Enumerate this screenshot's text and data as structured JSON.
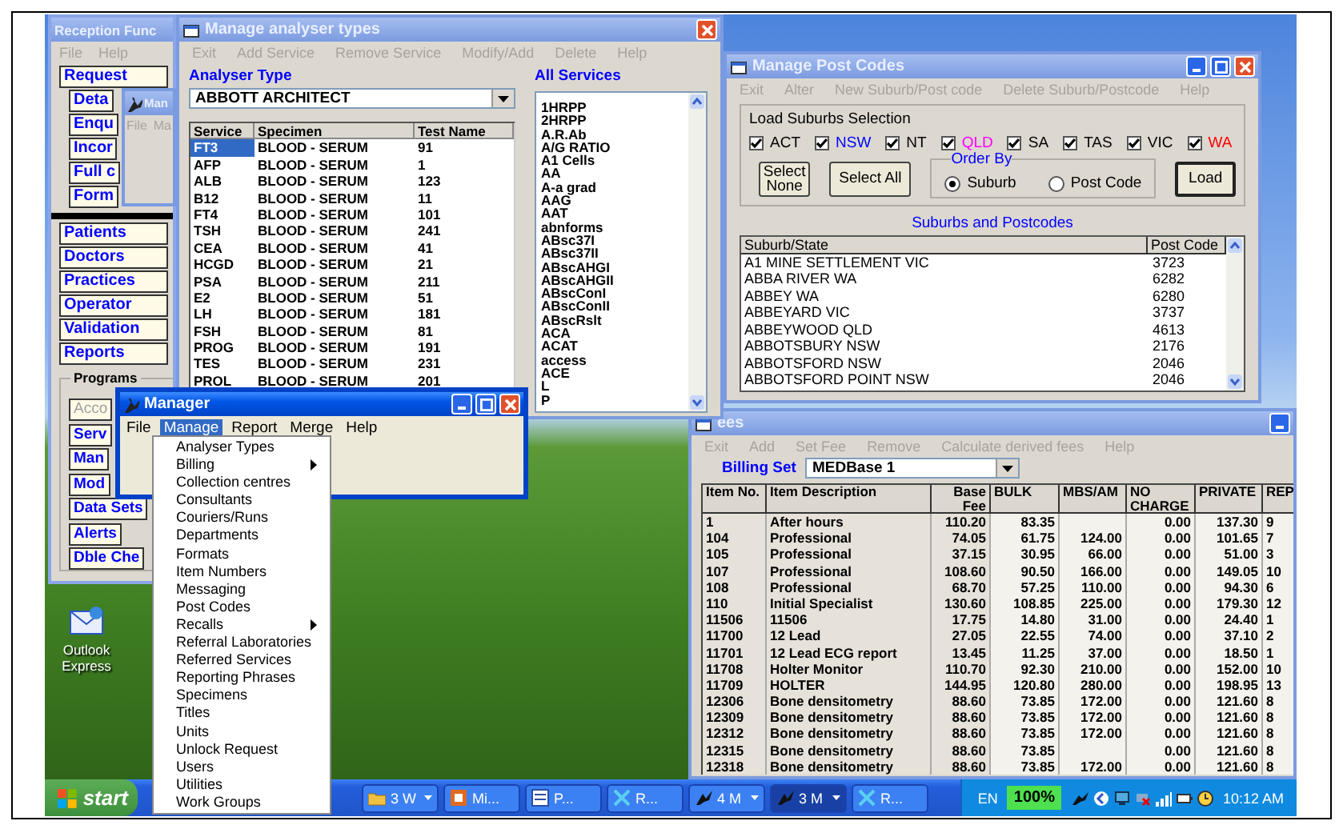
{
  "reception_window": {
    "title": "Reception Func",
    "active": false,
    "menu": [
      {
        "label": "File",
        "disabled": true
      },
      {
        "label": "Help",
        "disabled": true
      }
    ],
    "buttons": [
      {
        "label": "Request",
        "kind": "main"
      },
      {
        "label": "Deta",
        "kind": "sub"
      },
      {
        "label": "Enqu",
        "kind": "sub"
      },
      {
        "label": "Incor",
        "kind": "sub"
      },
      {
        "label": "Full c",
        "kind": "sub"
      },
      {
        "label": "Form",
        "kind": "sub"
      }
    ],
    "lower_buttons": [
      {
        "label": "Patients"
      },
      {
        "label": "Doctors"
      },
      {
        "label": "Practices"
      },
      {
        "label": "Operator"
      },
      {
        "label": "Validation"
      },
      {
        "label": "Reports"
      }
    ],
    "programs": {
      "label": "Programs",
      "buttons": [
        {
          "label": "Acco",
          "disabled": true
        },
        {
          "label": "Serv",
          "disabled": false
        },
        {
          "label": "Man",
          "disabled": false
        },
        {
          "label": "Mod",
          "disabled": false
        },
        {
          "label": "Data Sets",
          "disabled": false
        },
        {
          "label": "Alerts",
          "disabled": false
        },
        {
          "label": "Dble Che",
          "disabled": false
        }
      ]
    }
  },
  "small_window": {
    "title": "Man",
    "active": false,
    "menu": [
      {
        "label": "File",
        "disabled": true
      },
      {
        "label": "Ma",
        "disabled": true
      }
    ]
  },
  "analyser_window": {
    "title": "Manage analyser types",
    "active": false,
    "menu": [
      {
        "label": "Exit",
        "disabled": true
      },
      {
        "label": "Add Service",
        "disabled": true
      },
      {
        "label": "Remove Service",
        "disabled": true
      },
      {
        "label": "Modify/Add",
        "disabled": true
      },
      {
        "label": "Delete",
        "disabled": true
      },
      {
        "label": "Help",
        "disabled": true
      }
    ],
    "analyser_type_label": "Analyser Type",
    "analyser_type": "ABBOTT ARCHITECT",
    "table": {
      "columns": [
        "Service",
        "Specimen",
        "Test Name"
      ],
      "rows": [
        {
          "cells": [
            "FT3",
            "BLOOD - SERUM",
            "91"
          ],
          "selected": true
        },
        {
          "cells": [
            "AFP",
            "BLOOD - SERUM",
            "1"
          ],
          "selected": false
        },
        {
          "cells": [
            "ALB",
            "BLOOD - SERUM",
            "123"
          ],
          "selected": false
        },
        {
          "cells": [
            "B12",
            "BLOOD - SERUM",
            "11"
          ],
          "selected": false
        },
        {
          "cells": [
            "FT4",
            "BLOOD - SERUM",
            "101"
          ],
          "selected": false
        },
        {
          "cells": [
            "TSH",
            "BLOOD - SERUM",
            "241"
          ],
          "selected": false
        },
        {
          "cells": [
            "CEA",
            "BLOOD - SERUM",
            "41"
          ],
          "selected": false
        },
        {
          "cells": [
            "HCGD",
            "BLOOD - SERUM",
            "21"
          ],
          "selected": false
        },
        {
          "cells": [
            "PSA",
            "BLOOD - SERUM",
            "211"
          ],
          "selected": false
        },
        {
          "cells": [
            "E2",
            "BLOOD - SERUM",
            "51"
          ],
          "selected": false
        },
        {
          "cells": [
            "LH",
            "BLOOD - SERUM",
            "181"
          ],
          "selected": false
        },
        {
          "cells": [
            "FSH",
            "BLOOD - SERUM",
            "81"
          ],
          "selected": false
        },
        {
          "cells": [
            "PROG",
            "BLOOD - SERUM",
            "191"
          ],
          "selected": false
        },
        {
          "cells": [
            "TES",
            "BLOOD - SERUM",
            "231"
          ],
          "selected": false
        },
        {
          "cells": [
            "PROL",
            "BLOOD - SERUM",
            "201"
          ],
          "selected": false
        }
      ]
    },
    "all_services_label": "All Services",
    "all_services": [
      "1HRPP",
      "2HRPP",
      "A.R.Ab",
      "A/G RATIO",
      "A1 Cells",
      "AA",
      "A-a grad",
      "AAG",
      "AAT",
      "abnforms",
      "ABsc37I",
      "ABsc37II",
      "ABscAHGI",
      "ABscAHGII",
      "ABscConI",
      "ABscConII",
      "ABscRslt",
      "ACA",
      "ACAT",
      "access",
      "ACE",
      "L",
      "P"
    ]
  },
  "postcodes_window": {
    "title": "Manage Post Codes",
    "active": false,
    "menu": [
      {
        "label": "Exit",
        "disabled": true
      },
      {
        "label": "Alter",
        "disabled": true
      },
      {
        "label": "New Suburb/Post code",
        "disabled": true
      },
      {
        "label": "Delete Suburb/Postcode",
        "disabled": true
      },
      {
        "label": "Help",
        "disabled": true
      }
    ],
    "selection_label": "Load Suburbs Selection",
    "states": [
      {
        "label": "ACT",
        "checked": true,
        "color": "#000000"
      },
      {
        "label": "NSW",
        "checked": true,
        "color": "#0000ff"
      },
      {
        "label": "NT",
        "checked": true,
        "color": "#000000"
      },
      {
        "label": "QLD",
        "checked": true,
        "color": "#ff00ff"
      },
      {
        "label": "SA",
        "checked": true,
        "color": "#000000"
      },
      {
        "label": "TAS",
        "checked": true,
        "color": "#000000"
      },
      {
        "label": "VIC",
        "checked": true,
        "color": "#000000"
      },
      {
        "label": "WA",
        "checked": true,
        "color": "#ff0000"
      }
    ],
    "select_none": "Select None",
    "select_all": "Select All",
    "order_by": {
      "label": "Order By",
      "options": [
        {
          "label": "Suburb",
          "selected": true
        },
        {
          "label": "Post Code",
          "selected": false
        }
      ]
    },
    "load": "Load",
    "list_title": "Suburbs and Postcodes",
    "table": {
      "columns": [
        "Suburb/State",
        "Post Code"
      ],
      "rows": [
        [
          "A1 MINE SETTLEMENT VIC",
          "3723"
        ],
        [
          "ABBA RIVER WA",
          "6282"
        ],
        [
          "ABBEY WA",
          "6280"
        ],
        [
          "ABBEYARD VIC",
          "3737"
        ],
        [
          "ABBEYWOOD QLD",
          "4613"
        ],
        [
          "ABBOTSBURY NSW",
          "2176"
        ],
        [
          "ABBOTSFORD NSW",
          "2046"
        ],
        [
          "ABBOTSFORD POINT NSW",
          "2046"
        ]
      ]
    }
  },
  "fees_window": {
    "title": "ees",
    "active": false,
    "menu": [
      {
        "label": "Exit",
        "disabled": true
      },
      {
        "label": "Add",
        "disabled": true
      },
      {
        "label": "Set Fee",
        "disabled": true
      },
      {
        "label": "Remove",
        "disabled": true
      },
      {
        "label": "Calculate derived fees",
        "disabled": true
      },
      {
        "label": "Help",
        "disabled": true
      }
    ],
    "billing_set_label": "Billing Set",
    "billing_set": "MEDBase 1",
    "table": {
      "columns": [
        "Item No.",
        "Item Description",
        "Base Fee",
        "BULK",
        "MBS/AM",
        "NO CHARGE",
        "PRIVATE",
        "REP"
      ],
      "rows": [
        [
          "1",
          "After hours",
          "110.20",
          "83.35",
          null,
          "0.00",
          "137.30",
          "9"
        ],
        [
          "104",
          "Professional",
          "74.05",
          "61.75",
          "124.00",
          "0.00",
          "101.65",
          "7"
        ],
        [
          "105",
          "Professional",
          "37.15",
          "30.95",
          "66.00",
          "0.00",
          "51.00",
          "3"
        ],
        [
          "107",
          "Professional",
          "108.60",
          "90.50",
          "166.00",
          "0.00",
          "149.05",
          "10"
        ],
        [
          "108",
          "Professional",
          "68.70",
          "57.25",
          "110.00",
          "0.00",
          "94.30",
          "6"
        ],
        [
          "110",
          "Initial Specialist",
          "130.60",
          "108.85",
          "225.00",
          "0.00",
          "179.30",
          "12"
        ],
        [
          "11506",
          "11506",
          "17.75",
          "14.80",
          "31.00",
          "0.00",
          "24.40",
          "1"
        ],
        [
          "11700",
          "12 Lead",
          "27.05",
          "22.55",
          "74.00",
          "0.00",
          "37.10",
          "2"
        ],
        [
          "11701",
          "12 Lead ECG report",
          "13.45",
          "11.25",
          "37.00",
          "0.00",
          "18.50",
          "1"
        ],
        [
          "11708",
          "Holter Monitor",
          "110.70",
          "92.30",
          "210.00",
          "0.00",
          "152.00",
          "10"
        ],
        [
          "11709",
          "HOLTER",
          "144.95",
          "120.80",
          "280.00",
          "0.00",
          "198.95",
          "13"
        ],
        [
          "12306",
          "Bone densitometry",
          "88.60",
          "73.85",
          "172.00",
          "0.00",
          "121.60",
          "8"
        ],
        [
          "12309",
          "Bone densitometry",
          "88.60",
          "73.85",
          "172.00",
          "0.00",
          "121.60",
          "8"
        ],
        [
          "12312",
          "Bone densitometry",
          "88.60",
          "73.85",
          "172.00",
          "0.00",
          "121.60",
          "8"
        ],
        [
          "12315",
          "Bone densitometry",
          "88.60",
          "73.85",
          null,
          "0.00",
          "121.60",
          "8"
        ],
        [
          "12318",
          "Bone densitometry",
          "88.60",
          "73.85",
          "172.00",
          "0.00",
          "121.60",
          "8"
        ]
      ]
    }
  },
  "manager_window": {
    "title": "Manager",
    "active": true,
    "menu": [
      {
        "label": "File",
        "selected": false
      },
      {
        "label": "Manage",
        "selected": true
      },
      {
        "label": "Report",
        "selected": false
      },
      {
        "label": "Merge",
        "selected": false
      },
      {
        "label": "Help",
        "selected": false
      }
    ],
    "dropdown": [
      {
        "label": "Analyser Types",
        "submenu": false
      },
      {
        "label": "Billing",
        "submenu": true
      },
      {
        "label": "Collection centres",
        "submenu": false
      },
      {
        "label": "Consultants",
        "submenu": false
      },
      {
        "label": "Couriers/Runs",
        "submenu": false
      },
      {
        "label": "Departments",
        "submenu": false
      },
      {
        "label": "Formats",
        "submenu": false
      },
      {
        "label": "Item Numbers",
        "submenu": false
      },
      {
        "label": "Messaging",
        "submenu": false
      },
      {
        "label": "Post Codes",
        "submenu": false
      },
      {
        "label": "Recalls",
        "submenu": true
      },
      {
        "label": "Referral Laboratories",
        "submenu": false
      },
      {
        "label": "Referred Services",
        "submenu": false
      },
      {
        "label": "Reporting Phrases",
        "submenu": false
      },
      {
        "label": "Specimens",
        "submenu": false
      },
      {
        "label": "Titles",
        "submenu": false
      },
      {
        "label": "Units",
        "submenu": false
      },
      {
        "label": "Unlock Request",
        "submenu": false
      },
      {
        "label": "Users",
        "submenu": false
      },
      {
        "label": "Utilities",
        "submenu": false
      },
      {
        "label": "Work Groups",
        "submenu": false
      }
    ]
  },
  "desktop_icon": {
    "label": "Outlook Express"
  },
  "taskbar": {
    "start": "start",
    "tasks": [
      {
        "label": "3 W",
        "kind": "folder",
        "grouped": true,
        "selected": false
      },
      {
        "label": "Mi...",
        "kind": "slides",
        "grouped": false,
        "selected": false
      },
      {
        "label": "P...",
        "kind": "document",
        "grouped": false,
        "selected": false
      },
      {
        "label": "R...",
        "kind": "app",
        "grouped": false,
        "selected": false
      },
      {
        "label": "4 M",
        "kind": "program",
        "grouped": true,
        "selected": false
      },
      {
        "label": "3 M",
        "kind": "program",
        "grouped": true,
        "selected": true
      },
      {
        "label": "R...",
        "kind": "app",
        "grouped": false,
        "selected": false
      }
    ],
    "language": "EN",
    "battery": "100%",
    "clock": "10:12 AM"
  }
}
